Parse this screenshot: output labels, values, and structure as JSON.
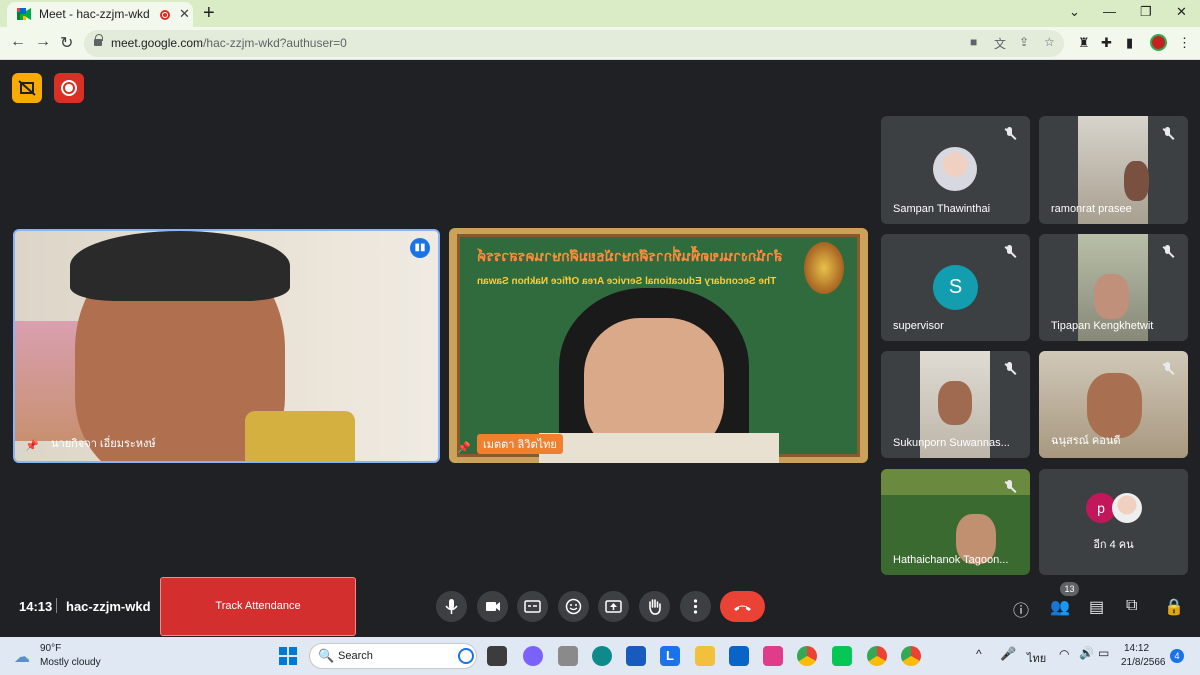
{
  "browser": {
    "tab_title": "Meet - hac-zzjm-wkd",
    "url_host": "meet.google.com",
    "url_path": "/hac-zzjm-wkd?authuser=0"
  },
  "meeting": {
    "time": "14:13",
    "code": "hac-zzjm-wkd",
    "participant_count": "13",
    "track_attendance_label": "Track Attendance"
  },
  "main_tiles": [
    {
      "name": "นายกิจจา เอี่ยมระหงษ์"
    },
    {
      "name": "เมตตา ลิวิตไทย",
      "banner_th": "สำนักงานเขตพื้นที่การศึกษามัธยมศึกษานครสวรรค์",
      "banner_en": "The Secondary Educational Service Area Office Nakhon Sawan"
    }
  ],
  "side_tiles": [
    {
      "name": "Sampan Thawinthai"
    },
    {
      "name": "ramonrat prasee"
    },
    {
      "name": "supervisor",
      "initial": "S"
    },
    {
      "name": "Tipapan Kengkhetwit"
    },
    {
      "name": "Sukunporn Suwannas..."
    },
    {
      "name": "ฉนุสรณ์ คอนดี"
    },
    {
      "name": "Hathaichanok Tagoon..."
    },
    {
      "name": "อีก 4 คน",
      "initial": "p"
    }
  ],
  "taskbar": {
    "weather_temp": "90°F",
    "weather_desc": "Mostly cloudy",
    "search_label": "Search",
    "lang": "ไทย",
    "clock_time": "14:12",
    "clock_date": "21/8/2566",
    "notif_count": "4"
  },
  "colors": {
    "meet_bg": "#202124",
    "active_speaker_border": "#8ab4f8",
    "end_call": "#ea4335",
    "track_attendance_bg": "#d32f2f"
  }
}
